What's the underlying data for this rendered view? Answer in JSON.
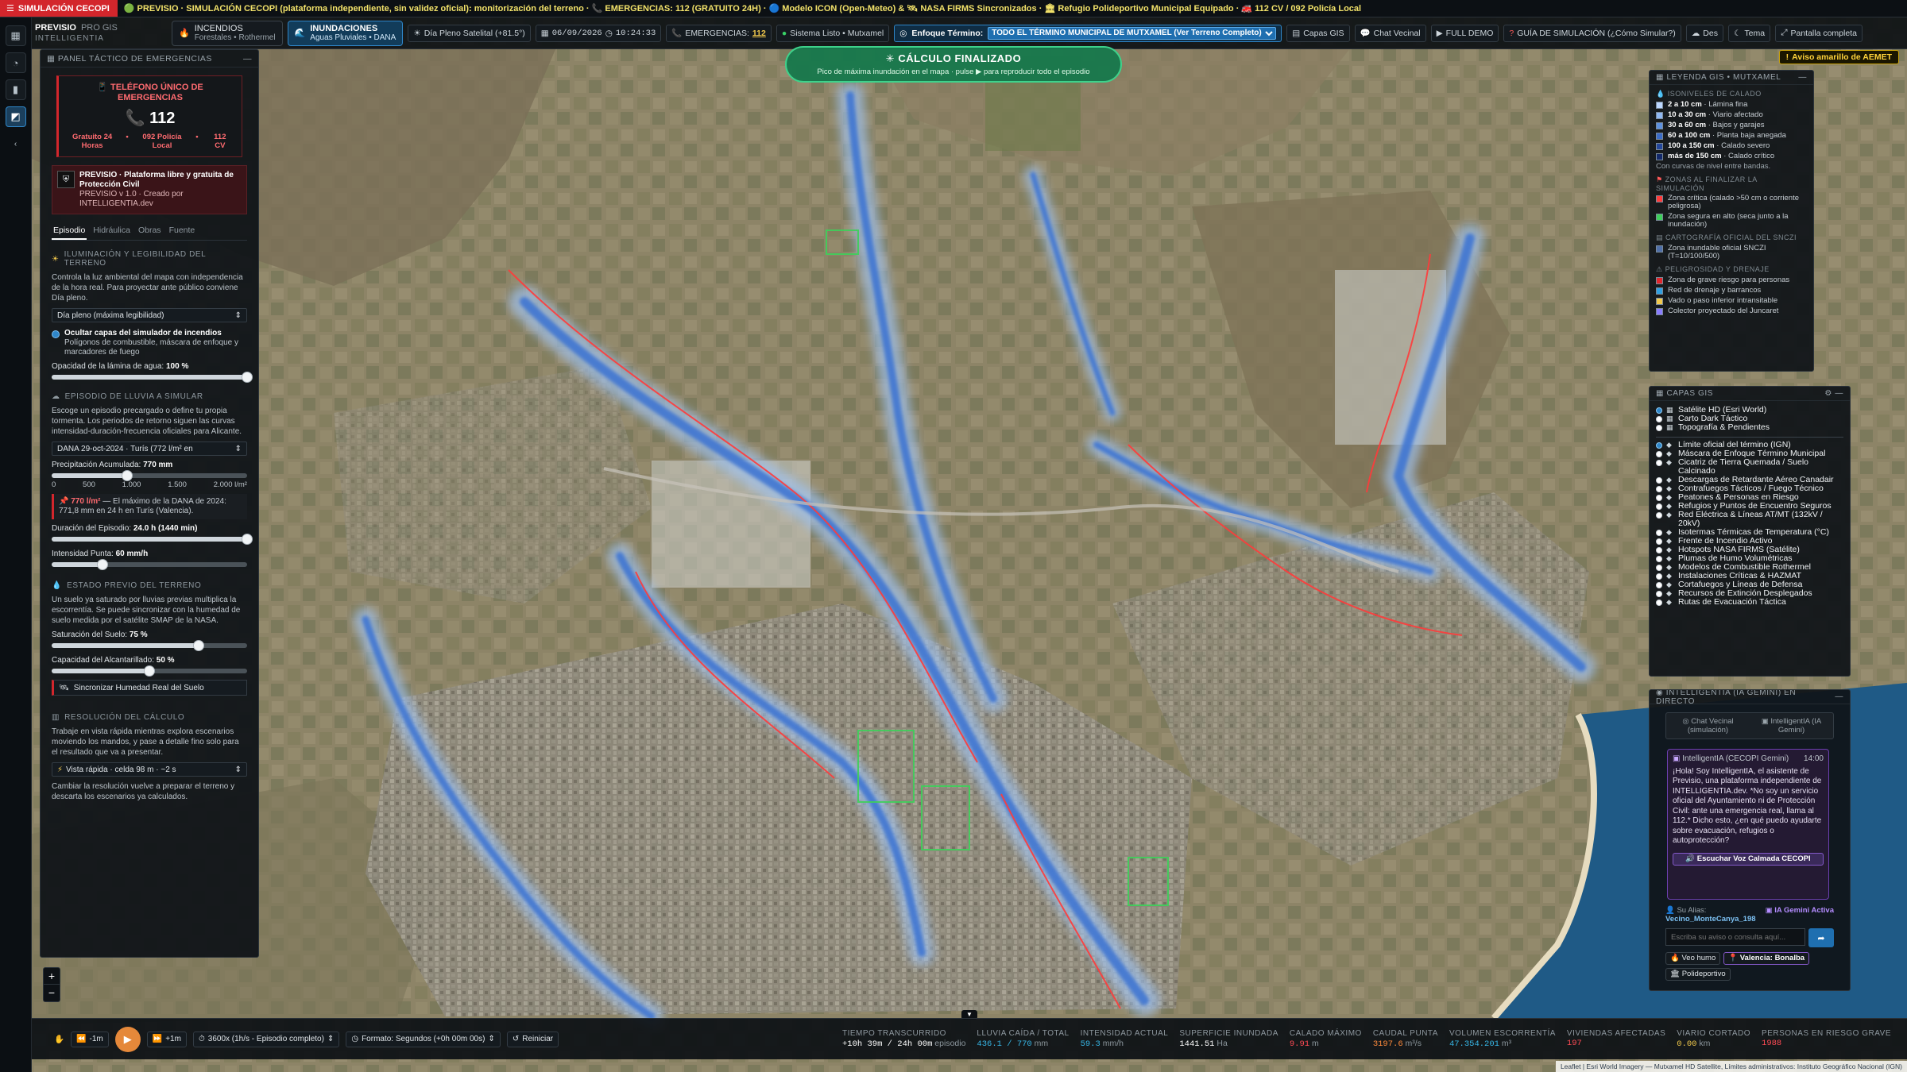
{
  "topbar": {
    "badge": "SIMULACIÓN CECOPI",
    "ticker": "🟢 PREVISIO · SIMULACIÓN CECOPI (plataforma independiente, sin validez oficial): monitorización del terreno · 📞 EMERGENCIAS: 112 (GRATUITO 24H) · 🔵 Modelo ICON (Open-Meteo) & 🛰 NASA FIRMS Sincronizados · 🏛 Refugio Polideportivo Municipal Equipado · 🚒 112 CV / 092 Policía Local"
  },
  "header": {
    "brand_title": "PREVISIO",
    "brand_version": "PRO GIS",
    "brand_sub": "INTELLIGENTIA",
    "mode_incendios": {
      "title": "INCENDIOS",
      "sub": "Forestales • Rothermel"
    },
    "mode_inundaciones": {
      "title": "INUNDACIONES",
      "sub": "Aguas Pluviales • DANA"
    },
    "chip_dia": "Día Pleno Satelital (+81.5°)",
    "chip_date": "06/09/2026",
    "chip_time": "10:24:33",
    "chip_emerg_label": "EMERGENCIAS:",
    "chip_emerg_num": "112",
    "chip_status": "Sistema Listo • Mutxamel",
    "focus_label": "Enfoque Término:",
    "focus_value": "TODO EL TÉRMINO MUNICIPAL DE MUTXAMEL (Ver Terreno Completo)",
    "btn_capas": "Capas GIS",
    "btn_chat": "Chat Vecinal",
    "btn_demo": "FULL DEMO",
    "btn_guia": "GUÍA DE SIMULACIÓN (¿Cómo Simular?)",
    "btn_des": "Des",
    "btn_tema": "Tema",
    "btn_full": "Pantalla completa"
  },
  "aemet": "Aviso amarillo de AEMET",
  "left_panel": {
    "title": "PANEL TÁCTICO DE EMERGENCIAS",
    "emerg_title": "TELÉFONO ÚNICO DE EMERGENCIAS",
    "emerg_num": "112",
    "emerg_a": "Gratuito 24 Horas",
    "emerg_b": "092 Policía Local",
    "emerg_c": "112 CV",
    "prev_title": "PREVISIO · Plataforma libre y gratuita de Protección Civil",
    "prev_sub": "PREVISIO v 1.0 · Creado por INTELLIGENTIA.dev",
    "tabs": [
      "Episodio",
      "Hidráulica",
      "Obras",
      "Fuente"
    ],
    "s1_title": "ILUMINACIÓN Y LEGIBILIDAD DEL TERRENO",
    "s1_text": "Controla la luz ambiental del mapa con independencia de la hora real. Para proyectar ante público conviene Día pleno.",
    "s1_select": "Día pleno (máxima legibilidad)",
    "s1_check_title": "Ocultar capas del simulador de incendios",
    "s1_check_text": "Polígonos de combustible, máscara de enfoque y marcadores de fuego",
    "s1_opacity_label": "Opacidad de la lámina de agua:",
    "s1_opacity_value": "100 %",
    "s1_opacity_pct": 100,
    "s2_title": "EPISODIO DE LLUVIA A SIMULAR",
    "s2_text": "Escoge un episodio precargado o define tu propia tormenta. Los periodos de retorno siguen las curvas intensidad-duración-frecuencia oficiales para Alicante.",
    "s2_select": "DANA 29-oct-2024 · Turís (772 l/m² en",
    "s2_precip_label": "Precipitación Acumulada:",
    "s2_precip_value": "770 mm",
    "s2_precip_pct": 38.5,
    "s2_ticks": [
      "0",
      "500",
      "1.000",
      "1.500",
      "2.000 l/m²"
    ],
    "s2_note_bold": "770 l/m²",
    "s2_note": " — El máximo de la DANA de 2024: 771,8 mm en 24 h en Turís (Valencia).",
    "s2_dur_label": "Duración del Episodio:",
    "s2_dur_value": "24.0 h (1440 min)",
    "s2_dur_pct": 100,
    "s2_int_label": "Intensidad Punta:",
    "s2_int_value": "60 mm/h",
    "s2_int_pct": 26,
    "s3_title": "ESTADO PREVIO DEL TERRENO",
    "s3_text": "Un suelo ya saturado por lluvias previas multiplica la escorrentía. Se puede sincronizar con la humedad de suelo medida por el satélite SMAP de la NASA.",
    "s3_sat_label": "Saturación del Suelo:",
    "s3_sat_value": "75 %",
    "s3_sat_pct": 75,
    "s3_cap_label": "Capacidad del Alcantarillado:",
    "s3_cap_value": "50 %",
    "s3_cap_pct": 50,
    "s3_btn": "Sincronizar Humedad Real del Suelo",
    "s4_title": "RESOLUCIÓN DEL CÁLCULO",
    "s4_text": "Trabaje en vista rápida mientras explora escenarios moviendo los mandos, y pase a detalle fino solo para el resultado que va a presentar.",
    "s4_select": "Vista rápida · celda 98 m · ~2 s",
    "s4_text2": "Cambiar la resolución vuelve a preparar el terreno y descarta los escenarios ya calculados."
  },
  "banner": {
    "title": "CÁLCULO FINALIZADO",
    "sub": "Pico de máxima inundación en el mapa · pulse ▶ para reproducir todo el episodio"
  },
  "legend": {
    "title": "LEYENDA GIS • MUTXAMEL",
    "sec1": "ISONIVELES DE CALADO",
    "rows1": [
      {
        "b": "2 a 10 cm",
        "t": "· Lámina fina",
        "color": "#bcd7ff"
      },
      {
        "b": "10 a 30 cm",
        "t": "· Viario afectado",
        "color": "#8fb8f2"
      },
      {
        "b": "30 a 60 cm",
        "t": "· Bajos y garajes",
        "color": "#5d91e0"
      },
      {
        "b": "60 a 100 cm",
        "t": "· Planta baja anegada",
        "color": "#3b6cc7"
      },
      {
        "b": "100 a 150 cm",
        "t": "· Calado severo",
        "color": "#23479c"
      },
      {
        "b": "más de 150 cm",
        "t": "· Calado crítico",
        "color": "#13296a"
      }
    ],
    "note": "Con curvas de nivel entre bandas.",
    "sec2": "ZONAS AL FINALIZAR LA SIMULACIÓN",
    "rows2": [
      {
        "t": "Zona crítica (calado >50 cm o corriente peligrosa)",
        "color": "#ff3b3b"
      },
      {
        "t": "Zona segura en alto (seca junto a la inundación)",
        "color": "#3ecf5a"
      }
    ],
    "sec3": "CARTOGRAFÍA OFICIAL DEL SNCZI",
    "rows3": [
      {
        "t": "Zona inundable oficial SNCZI (T=10/100/500)",
        "color": "#4f6fa8"
      }
    ],
    "sec4": "PELIGROSIDAD Y DRENAJE",
    "rows4": [
      {
        "t": "Zona de grave riesgo para personas",
        "color": "#e0262c"
      },
      {
        "t": "Red de drenaje y barrancos",
        "color": "#2f9fe0"
      },
      {
        "t": "Vado o paso inferior intransitable",
        "color": "#f2c94c"
      },
      {
        "t": "Colector proyectado del Juncaret",
        "color": "#8a7dff"
      }
    ]
  },
  "layers": {
    "title": "CAPAS GIS",
    "base": [
      {
        "label": "Satélite HD (Esri World)",
        "on": true
      },
      {
        "label": "Carto Dark Táctico",
        "on": false
      },
      {
        "label": "Topografía & Pendientes",
        "on": false
      }
    ],
    "overlays": [
      "Límite oficial del término (IGN)",
      "Máscara de Enfoque Término Municipal",
      "Cicatriz de Tierra Quemada / Suelo Calcinado",
      "Descargas de Retardante Aéreo Canadair",
      "Contrafuegos Tácticos / Fuego Técnico",
      "Peatones & Personas en Riesgo",
      "Refugios y Puntos de Encuentro Seguros",
      "Red Eléctrica & Líneas AT/MT (132kV / 20kV)",
      "Isotermas Térmicas de Temperatura (°C)",
      "Frente de Incendio Activo",
      "Hotspots NASA FIRMS (Satélite)",
      "Plumas de Humo Volumétricas",
      "Modelos de Combustible Rothermel",
      "Instalaciones Críticas & HAZMAT",
      "Cortafuegos y Líneas de Defensa",
      "Recursos de Extinción Desplegados",
      "Rutas de Evacuación Táctica"
    ]
  },
  "ai": {
    "title": "INTELLIGENTIA (IA GEMINI) EN DIRECTO",
    "tab1": "Chat Vecinal (simulación)",
    "tab2": "IntelligentIA (IA Gemini)",
    "msg_from": "IntelligentIA (CECOPI Gemini)",
    "msg_time": "14:00",
    "msg_text": "¡Hola! Soy IntelligentIA, el asistente de Previsio, una plataforma independiente de INTELLIGENTIA.dev. *No soy un servicio oficial del Ayuntamiento ni de Protección Civil: ante una emergencia real, llama al 112.* Dicho esto, ¿en qué puedo ayudarte sobre evacuación, refugios o autoprotección?",
    "voice_btn": "Escuchar Voz Calmada CECOPI",
    "alias_label": "Su Alias:",
    "alias": "Vecino_MonteCanya_198",
    "status": "IA Gemini Activa",
    "input_ph": "Escriba su aviso o consulta aquí...",
    "chips": [
      "Veo humo",
      "Valencia: Bonalba",
      "Polideportivo"
    ]
  },
  "bottom": {
    "btn_m1": "-1m",
    "btn_p1": "+1m",
    "speed": "3600x (1h/s - Episodio completo)",
    "format": "Formato: Segundos (+0h 00m 00s)",
    "reset": "Reiniciar",
    "stats": [
      {
        "k": "TIEMPO TRANSCURRIDO",
        "v": "+10h 39m / 24h 00m",
        "u": "episodio",
        "cls": ""
      },
      {
        "k": "LLUVIA CAÍDA / TOTAL",
        "v": "436.1 / 770",
        "u": "mm",
        "cls": "c"
      },
      {
        "k": "INTENSIDAD ACTUAL",
        "v": "59.3",
        "u": "mm/h",
        "cls": "c"
      },
      {
        "k": "SUPERFICIE INUNDADA",
        "v": "1441.51",
        "u": "Ha",
        "cls": ""
      },
      {
        "k": "CALADO MÁXIMO",
        "v": "9.91",
        "u": "m",
        "cls": "r"
      },
      {
        "k": "CAUDAL PUNTA",
        "v": "3197.6",
        "u": "m³/s",
        "cls": "o"
      },
      {
        "k": "VOLUMEN ESCORRENTÍA",
        "v": "47.354.201",
        "u": "m³",
        "cls": "c"
      },
      {
        "k": "VIVIENDAS AFECTADAS",
        "v": "197",
        "u": "",
        "cls": "r"
      },
      {
        "k": "VIARIO CORTADO",
        "v": "0.00",
        "u": "km",
        "cls": "y"
      },
      {
        "k": "PERSONAS EN RIESGO GRAVE",
        "v": "1988",
        "u": "",
        "cls": "r"
      }
    ]
  },
  "attribution": "Leaflet | Esri World Imagery — Mutxamel HD Satellite, Límites administrativos: Instituto Geográfico Nacional (IGN)"
}
